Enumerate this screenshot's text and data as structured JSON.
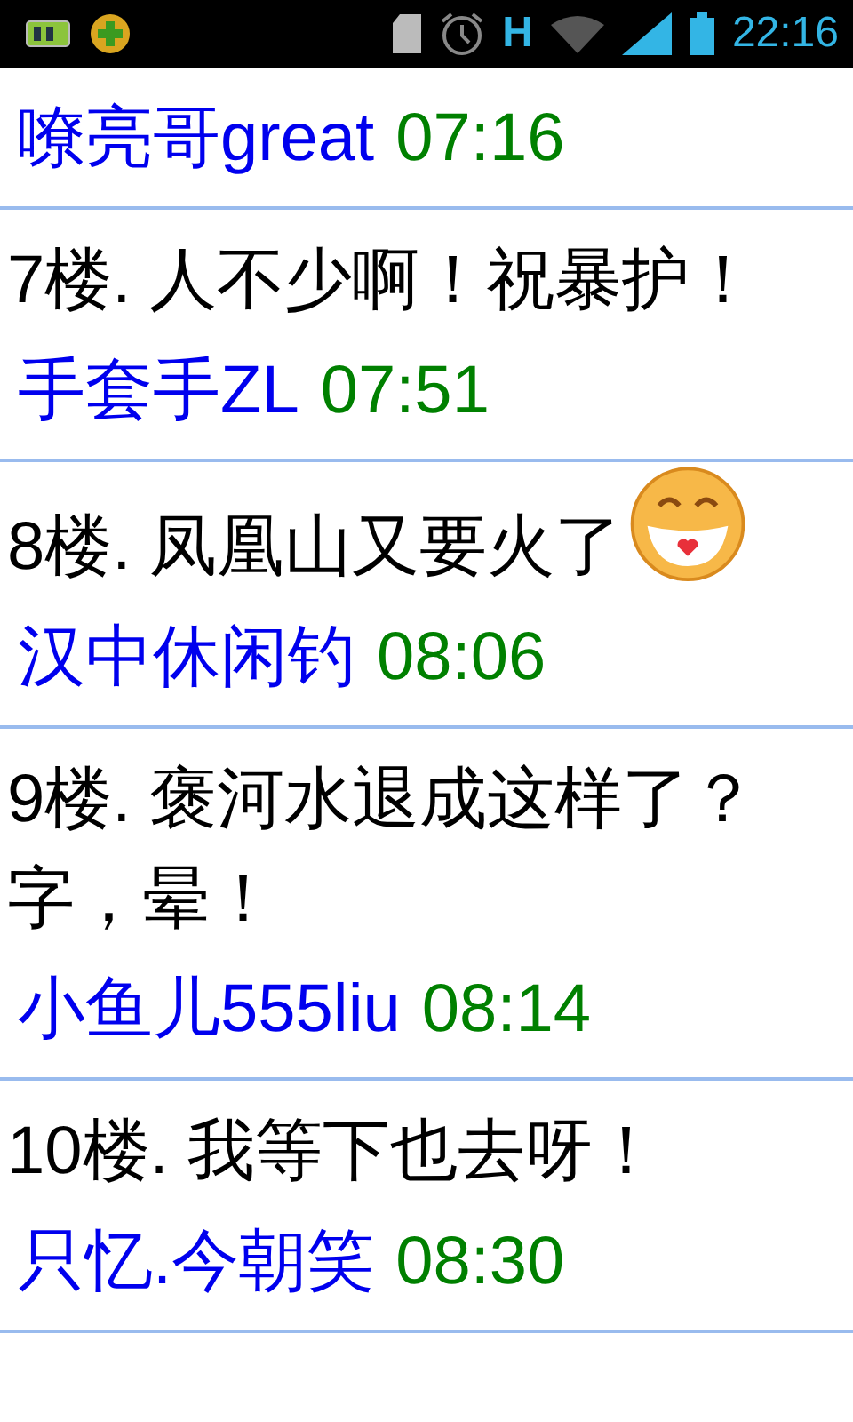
{
  "status_bar": {
    "network": "H",
    "time": "22:16"
  },
  "posts": [
    {
      "author": "嘹亮哥great",
      "time": "07:16"
    },
    {
      "text": "7楼. 人不少啊！祝暴护！",
      "author": "手套手ZL",
      "time": "07:51"
    },
    {
      "text": "8楼. 凤凰山又要火了",
      "emoji": true,
      "author": "汉中休闲钓",
      "time": "08:06"
    },
    {
      "text": "9楼. 褒河水退成这样了？字，晕！",
      "author": "小鱼儿555liu",
      "time": "08:14"
    },
    {
      "text": "10楼. 我等下也去呀！",
      "author": "只忆.今朝笑",
      "time": "08:30"
    }
  ]
}
